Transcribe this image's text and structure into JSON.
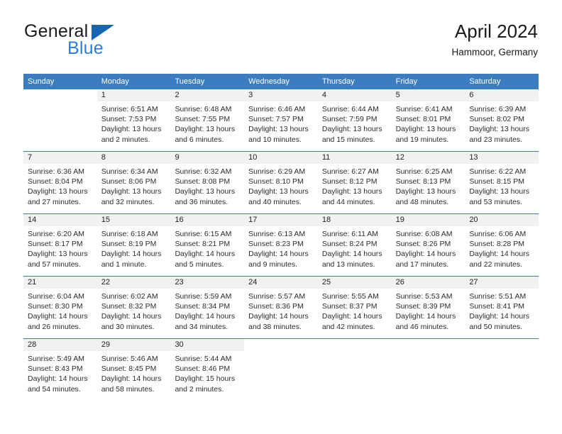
{
  "brand": {
    "word1": "General",
    "word2": "Blue"
  },
  "header": {
    "title": "April 2024",
    "subtitle": "Hammoor, Germany"
  },
  "weekday_headers": [
    "Sunday",
    "Monday",
    "Tuesday",
    "Wednesday",
    "Thursday",
    "Friday",
    "Saturday"
  ],
  "colors": {
    "header_blue": "#3b7dc0",
    "brand_blue": "#2a7fd4",
    "logo_triangle": "#1565b0",
    "day_band": "#f1f1f1",
    "text": "#2b2b2b"
  },
  "labels": {
    "sunrise_prefix": "Sunrise:",
    "sunset_prefix": "Sunset:",
    "daylight_prefix": "Daylight:"
  },
  "weeks": [
    [
      {
        "day": "",
        "empty": true,
        "sunrise": "",
        "sunset": "",
        "daylight": ""
      },
      {
        "day": "1",
        "sunrise": "Sunrise: 6:51 AM",
        "sunset": "Sunset: 7:53 PM",
        "daylight": "Daylight: 13 hours and 2 minutes."
      },
      {
        "day": "2",
        "sunrise": "Sunrise: 6:48 AM",
        "sunset": "Sunset: 7:55 PM",
        "daylight": "Daylight: 13 hours and 6 minutes."
      },
      {
        "day": "3",
        "sunrise": "Sunrise: 6:46 AM",
        "sunset": "Sunset: 7:57 PM",
        "daylight": "Daylight: 13 hours and 10 minutes."
      },
      {
        "day": "4",
        "sunrise": "Sunrise: 6:44 AM",
        "sunset": "Sunset: 7:59 PM",
        "daylight": "Daylight: 13 hours and 15 minutes."
      },
      {
        "day": "5",
        "sunrise": "Sunrise: 6:41 AM",
        "sunset": "Sunset: 8:01 PM",
        "daylight": "Daylight: 13 hours and 19 minutes."
      },
      {
        "day": "6",
        "sunrise": "Sunrise: 6:39 AM",
        "sunset": "Sunset: 8:02 PM",
        "daylight": "Daylight: 13 hours and 23 minutes."
      }
    ],
    [
      {
        "day": "7",
        "sunrise": "Sunrise: 6:36 AM",
        "sunset": "Sunset: 8:04 PM",
        "daylight": "Daylight: 13 hours and 27 minutes."
      },
      {
        "day": "8",
        "sunrise": "Sunrise: 6:34 AM",
        "sunset": "Sunset: 8:06 PM",
        "daylight": "Daylight: 13 hours and 32 minutes."
      },
      {
        "day": "9",
        "sunrise": "Sunrise: 6:32 AM",
        "sunset": "Sunset: 8:08 PM",
        "daylight": "Daylight: 13 hours and 36 minutes."
      },
      {
        "day": "10",
        "sunrise": "Sunrise: 6:29 AM",
        "sunset": "Sunset: 8:10 PM",
        "daylight": "Daylight: 13 hours and 40 minutes."
      },
      {
        "day": "11",
        "sunrise": "Sunrise: 6:27 AM",
        "sunset": "Sunset: 8:12 PM",
        "daylight": "Daylight: 13 hours and 44 minutes."
      },
      {
        "day": "12",
        "sunrise": "Sunrise: 6:25 AM",
        "sunset": "Sunset: 8:13 PM",
        "daylight": "Daylight: 13 hours and 48 minutes."
      },
      {
        "day": "13",
        "sunrise": "Sunrise: 6:22 AM",
        "sunset": "Sunset: 8:15 PM",
        "daylight": "Daylight: 13 hours and 53 minutes."
      }
    ],
    [
      {
        "day": "14",
        "sunrise": "Sunrise: 6:20 AM",
        "sunset": "Sunset: 8:17 PM",
        "daylight": "Daylight: 13 hours and 57 minutes."
      },
      {
        "day": "15",
        "sunrise": "Sunrise: 6:18 AM",
        "sunset": "Sunset: 8:19 PM",
        "daylight": "Daylight: 14 hours and 1 minute."
      },
      {
        "day": "16",
        "sunrise": "Sunrise: 6:15 AM",
        "sunset": "Sunset: 8:21 PM",
        "daylight": "Daylight: 14 hours and 5 minutes."
      },
      {
        "day": "17",
        "sunrise": "Sunrise: 6:13 AM",
        "sunset": "Sunset: 8:23 PM",
        "daylight": "Daylight: 14 hours and 9 minutes."
      },
      {
        "day": "18",
        "sunrise": "Sunrise: 6:11 AM",
        "sunset": "Sunset: 8:24 PM",
        "daylight": "Daylight: 14 hours and 13 minutes."
      },
      {
        "day": "19",
        "sunrise": "Sunrise: 6:08 AM",
        "sunset": "Sunset: 8:26 PM",
        "daylight": "Daylight: 14 hours and 17 minutes."
      },
      {
        "day": "20",
        "sunrise": "Sunrise: 6:06 AM",
        "sunset": "Sunset: 8:28 PM",
        "daylight": "Daylight: 14 hours and 22 minutes."
      }
    ],
    [
      {
        "day": "21",
        "sunrise": "Sunrise: 6:04 AM",
        "sunset": "Sunset: 8:30 PM",
        "daylight": "Daylight: 14 hours and 26 minutes."
      },
      {
        "day": "22",
        "sunrise": "Sunrise: 6:02 AM",
        "sunset": "Sunset: 8:32 PM",
        "daylight": "Daylight: 14 hours and 30 minutes."
      },
      {
        "day": "23",
        "sunrise": "Sunrise: 5:59 AM",
        "sunset": "Sunset: 8:34 PM",
        "daylight": "Daylight: 14 hours and 34 minutes."
      },
      {
        "day": "24",
        "sunrise": "Sunrise: 5:57 AM",
        "sunset": "Sunset: 8:36 PM",
        "daylight": "Daylight: 14 hours and 38 minutes."
      },
      {
        "day": "25",
        "sunrise": "Sunrise: 5:55 AM",
        "sunset": "Sunset: 8:37 PM",
        "daylight": "Daylight: 14 hours and 42 minutes."
      },
      {
        "day": "26",
        "sunrise": "Sunrise: 5:53 AM",
        "sunset": "Sunset: 8:39 PM",
        "daylight": "Daylight: 14 hours and 46 minutes."
      },
      {
        "day": "27",
        "sunrise": "Sunrise: 5:51 AM",
        "sunset": "Sunset: 8:41 PM",
        "daylight": "Daylight: 14 hours and 50 minutes."
      }
    ],
    [
      {
        "day": "28",
        "sunrise": "Sunrise: 5:49 AM",
        "sunset": "Sunset: 8:43 PM",
        "daylight": "Daylight: 14 hours and 54 minutes."
      },
      {
        "day": "29",
        "sunrise": "Sunrise: 5:46 AM",
        "sunset": "Sunset: 8:45 PM",
        "daylight": "Daylight: 14 hours and 58 minutes."
      },
      {
        "day": "30",
        "sunrise": "Sunrise: 5:44 AM",
        "sunset": "Sunset: 8:46 PM",
        "daylight": "Daylight: 15 hours and 2 minutes."
      },
      {
        "day": "",
        "empty": true,
        "sunrise": "",
        "sunset": "",
        "daylight": ""
      },
      {
        "day": "",
        "empty": true,
        "sunrise": "",
        "sunset": "",
        "daylight": ""
      },
      {
        "day": "",
        "empty": true,
        "sunrise": "",
        "sunset": "",
        "daylight": ""
      },
      {
        "day": "",
        "empty": true,
        "sunrise": "",
        "sunset": "",
        "daylight": ""
      }
    ]
  ]
}
